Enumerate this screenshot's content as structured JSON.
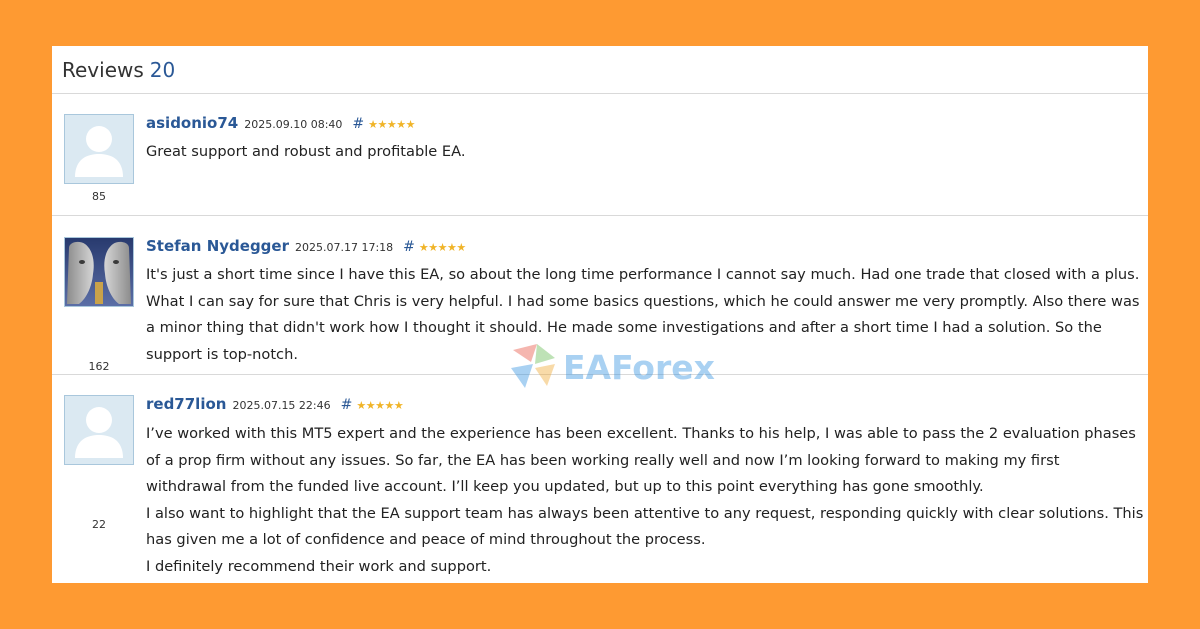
{
  "header": {
    "title": "Reviews",
    "count": "20"
  },
  "reviews": [
    {
      "author": "asidonio74",
      "date": "2025.09.10 08:40",
      "hash": "#",
      "stars": "★★★★★",
      "rating": "85",
      "avatar": "default-user-avatar",
      "paragraphs": [
        "Great support and robust and profitable EA."
      ]
    },
    {
      "author": "Stefan Nydegger",
      "date": "2025.07.17 17:18",
      "hash": "#",
      "stars": "★★★★★",
      "rating": "162",
      "avatar": "photo-avatar",
      "paragraphs": [
        "It's just a short time since I have this EA, so about the long time performance I cannot say much. Had one trade that closed with a plus. What I can say for sure that Chris is very helpful. I had some basics questions, which he could answer me very promptly. Also there was a minor thing that didn't work how I thought it should. He made some investigations and after a short time I had a solution. So the support is top-notch."
      ]
    },
    {
      "author": "red77lion",
      "date": "2025.07.15 22:46",
      "hash": "#",
      "stars": "★★★★★",
      "rating": "22",
      "avatar": "default-user-avatar",
      "paragraphs": [
        "I’ve worked with this MT5 expert and the experience has been excellent. Thanks to his help, I was able to pass the 2 evaluation phases of a prop firm without any issues. So far, the EA has been working really well and now I’m looking forward to making my first withdrawal from the funded live account. I’ll keep you updated, but up to this point everything has gone smoothly.",
        "I also want to highlight that the EA support team has always been attentive to any request, responding quickly with clear solutions. This has given me a lot of confidence and peace of mind throughout the process.",
        "I definitely recommend their work and support."
      ]
    }
  ],
  "watermark": {
    "text": "EAForex"
  },
  "colors": {
    "background": "#fe9a32",
    "link": "#2a5896",
    "star": "#f0b428"
  }
}
